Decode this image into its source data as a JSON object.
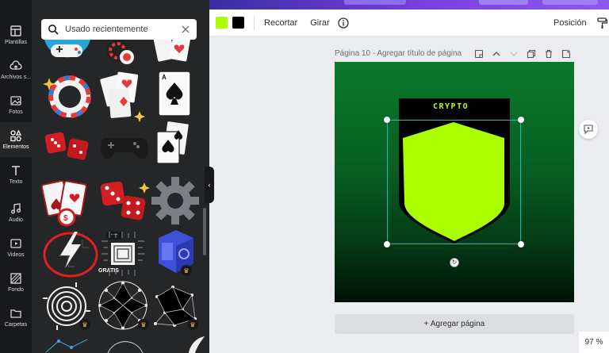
{
  "rail": {
    "items": [
      {
        "label": "Plantillas",
        "icon": "template-icon"
      },
      {
        "label": "Archivos s...",
        "icon": "upload-cloud-icon"
      },
      {
        "label": "Fotos",
        "icon": "photo-icon"
      },
      {
        "label": "Elementos",
        "icon": "shapes-icon"
      },
      {
        "label": "Texto",
        "icon": "text-icon"
      },
      {
        "label": "Audio",
        "icon": "music-note-icon"
      },
      {
        "label": "Videos",
        "icon": "video-play-icon"
      },
      {
        "label": "Fondo",
        "icon": "background-icon"
      },
      {
        "label": "Carpetas",
        "icon": "folder-icon"
      }
    ],
    "active_index": 3
  },
  "panel": {
    "search_value": "Usado recientemente",
    "badges": {
      "gratis": "GRATIS",
      "more": "···"
    }
  },
  "toolbar": {
    "colors": [
      "#aaff00",
      "#000000"
    ],
    "crop_label": "Recortar",
    "flip_label": "Girar",
    "position_label": "Posición"
  },
  "page": {
    "header": "Página 10 - Agregar título de página",
    "badge_text": "CRYPTO",
    "add_page_label": "+ Agregar página"
  },
  "zoom_label": "97 %",
  "accent": {
    "selection": "#00c4cc",
    "shield": "#aaff00",
    "canvas_bg": "#0a7a2a",
    "annotation_circle": "#e02020"
  }
}
